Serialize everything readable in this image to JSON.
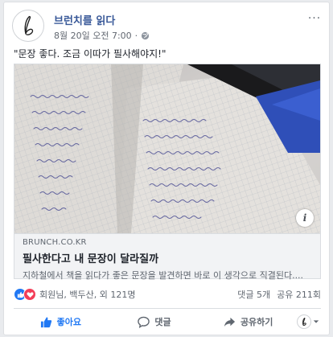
{
  "post": {
    "page_name": "브런치를 읽다",
    "timestamp": "8월 20일 오전 7:00",
    "separator": "·",
    "text": "\"문장 좋다. 조금 이따가 필사해야지!\"",
    "more_label": "···"
  },
  "link": {
    "domain": "BRUNCH.CO.KR",
    "title": "필사한다고 내 문장이 달라질까",
    "description": "지하철에서 책을 읽다가 좋은 문장을 발견하면 바로 이 생각으로 직결된다....",
    "info_label": "i"
  },
  "reactions": {
    "summary": "회원님, 백두산, 외 121명",
    "comments": "댓글 5개",
    "shares": "공유 211회"
  },
  "actions": {
    "like_label": "좋아요",
    "comment_label": "댓글",
    "share_label": "공유하기"
  },
  "colors": {
    "brand": "#385898",
    "like": "#2078f4",
    "love": "#f33e58"
  }
}
